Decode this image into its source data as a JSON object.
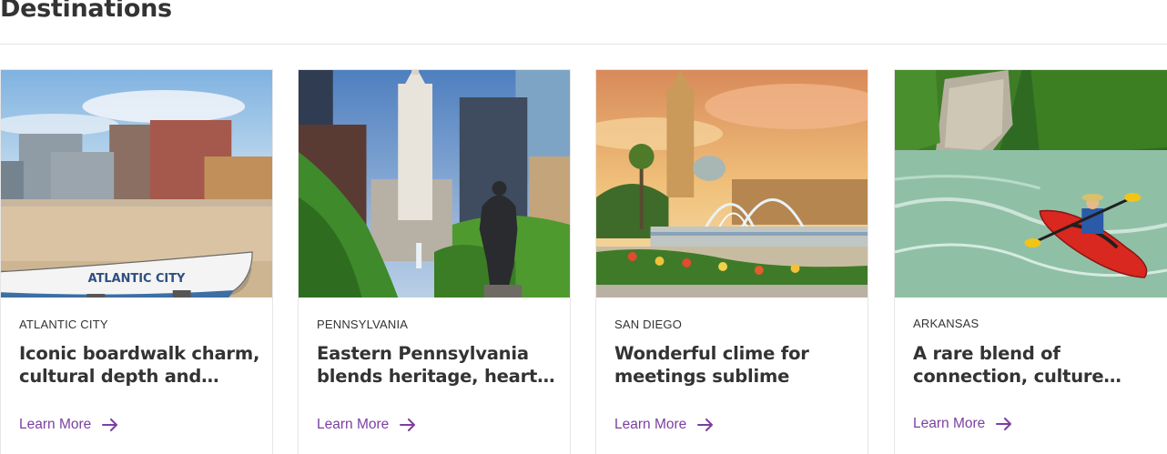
{
  "section": {
    "title": "Destinations"
  },
  "colors": {
    "link": "#7b3fa0",
    "text": "#333333",
    "border": "#e6e6e6"
  },
  "cards": [
    {
      "region": "ATLANTIC CITY",
      "headline": "Iconic boardwalk charm, cultural depth and high…",
      "link_label": "Learn More",
      "image_icon": "atlantic-city-boat-photo"
    },
    {
      "region": "PENNSYLVANIA",
      "headline": "Eastern Pennsylvania blends heritage, heart…",
      "link_label": "Learn More",
      "image_icon": "philadelphia-city-hall-photo"
    },
    {
      "region": "SAN DIEGO",
      "headline": "Wonderful clime for meetings sublime",
      "link_label": "Learn More",
      "image_icon": "san-diego-fountain-photo"
    },
    {
      "region": "ARKANSAS",
      "headline": "A rare blend of connection, culture and…",
      "link_label": "Learn More",
      "image_icon": "arkansas-kayak-photo"
    }
  ]
}
